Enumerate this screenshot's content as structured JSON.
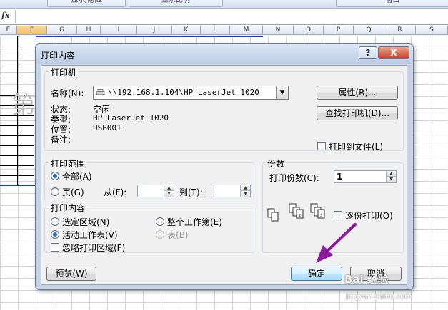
{
  "spreadsheet": {
    "ribbon_tabs": [
      "显示/隐藏",
      "显示比例",
      "窗口"
    ],
    "fx_label": "fx",
    "columns": [
      "E",
      "F",
      "G",
      "H",
      "I",
      "J",
      "K",
      "L",
      "M",
      "N",
      "O",
      "P",
      "Q",
      "R",
      "S"
    ],
    "cell_char": "第"
  },
  "dialog": {
    "title": "打印内容",
    "help_label": "?",
    "close_label": "X",
    "printer_group": {
      "label": "打印机",
      "name_label": "名称(N):",
      "name_value": "\\\\192.168.1.104\\HP LaserJet 1020",
      "status_label": "状态:",
      "status_value": "空闲",
      "type_label": "类型:",
      "type_value": "HP LaserJet 1020",
      "location_label": "位置:",
      "location_value": "USB001",
      "comment_label": "备注:",
      "properties_button": "属性(R)...",
      "find_button": "查找打印机(D)...",
      "print_to_file": "打印到文件(L)"
    },
    "range_group": {
      "label": "打印范围",
      "all": "全部(A)",
      "pages": "页(G)",
      "from": "从(F):",
      "to": "到(T):"
    },
    "content_group": {
      "label": "打印内容",
      "selection": "选定区域(N)",
      "active_sheets": "活动工作表(V)",
      "ignore_area": "忽略打印区域(F)",
      "entire_workbook": "整个工作簿(E)",
      "table": "表(B)"
    },
    "copies_group": {
      "label": "份数",
      "copies_label": "打印份数(C):",
      "copies_value": "1",
      "collate": "逐份打印(O)"
    },
    "preview_button": "预览(W)",
    "ok_button": "确定",
    "cancel_button": "取消"
  },
  "watermark": {
    "text": "Bai 经验",
    "url": "jingyan.baidu.com"
  },
  "colors": {
    "accent_arrow": "#8b1a9c",
    "selection_blue": "#1b3bd1"
  }
}
